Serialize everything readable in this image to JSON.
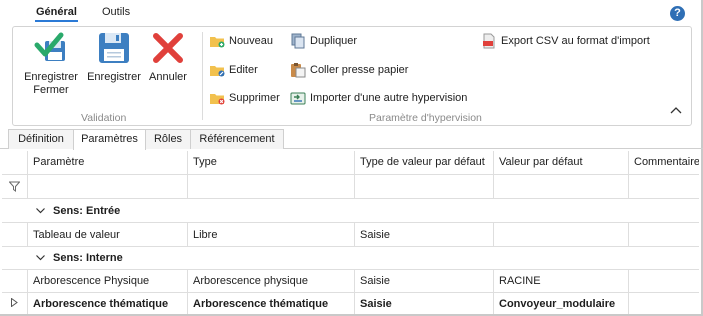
{
  "ribbon_tabs": [
    {
      "label": "Général",
      "active": true
    },
    {
      "label": "Outils",
      "active": false
    }
  ],
  "help_label": "?",
  "validation": {
    "group_label": "Validation",
    "save_close_line1": "Enregistrer",
    "save_close_line2": "Fermer",
    "save_label": "Enregistrer",
    "cancel_label": "Annuler"
  },
  "hypervision": {
    "group_label": "Paramètre d'hypervision",
    "new_label": "Nouveau",
    "edit_label": "Editer",
    "delete_label": "Supprimer",
    "duplicate_label": "Dupliquer",
    "paste_label": "Coller presse papier",
    "import_label": "Importer d'une autre hypervision",
    "export_label": "Export CSV au format d'import"
  },
  "doc_tabs": [
    {
      "label": "Définition",
      "active": false
    },
    {
      "label": "Paramètres",
      "active": true
    },
    {
      "label": "Rôles",
      "active": false
    },
    {
      "label": "Référencement",
      "active": false
    }
  ],
  "grid": {
    "columns": [
      "Paramètre",
      "Type",
      "Type de valeur par défaut",
      "Valeur par défaut",
      "Commentaire"
    ],
    "groups": [
      {
        "title": "Sens: Entrée",
        "rows": [
          {
            "param": "Tableau de valeur",
            "type": "Libre",
            "value_type": "Saisie",
            "default": "",
            "comment": "",
            "current": false
          }
        ]
      },
      {
        "title": "Sens: Interne",
        "rows": [
          {
            "param": "Arborescence Physique",
            "type": "Arborescence physique",
            "value_type": "Saisie",
            "default": "RACINE",
            "comment": "",
            "current": false
          },
          {
            "param": "Arborescence thématique",
            "type": "Arborescence thématique",
            "value_type": "Saisie",
            "default": "Convoyeur_modulaire",
            "comment": "",
            "current": true
          }
        ]
      }
    ]
  },
  "colors": {
    "accent": "#2b7ad6",
    "save_close_green": "#2aa96b",
    "save_blue": "#3d7fc1",
    "cancel_red": "#e0403b",
    "folder_yellow": "#f2c14e"
  }
}
